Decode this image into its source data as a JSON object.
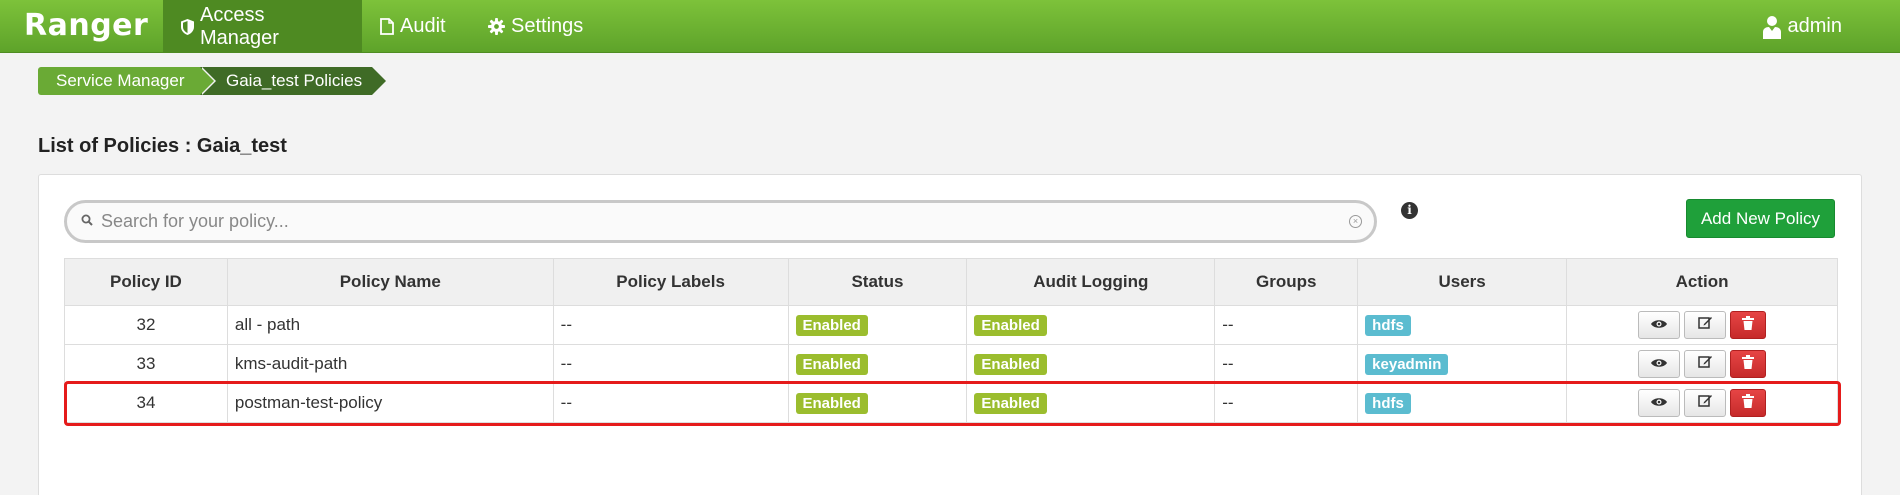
{
  "navbar": {
    "brand": "Ranger",
    "items": [
      {
        "label": "Access Manager",
        "icon": "shield-icon"
      },
      {
        "label": "Audit",
        "icon": "file-icon"
      },
      {
        "label": "Settings",
        "icon": "gear-icon"
      }
    ],
    "user": {
      "label": "admin",
      "icon": "user-icon"
    }
  },
  "breadcrumb": [
    "Service Manager",
    "Gaia_test Policies"
  ],
  "page_title": "List of Policies : Gaia_test",
  "search": {
    "placeholder": "Search for your policy..."
  },
  "add_button": "Add New Policy",
  "table": {
    "headers": [
      "Policy ID",
      "Policy Name",
      "Policy Labels",
      "Status",
      "Audit Logging",
      "Groups",
      "Users",
      "Action"
    ],
    "rows": [
      {
        "id": "32",
        "name": "all - path",
        "labels": "--",
        "status": "Enabled",
        "audit": "Enabled",
        "groups": "--",
        "users": "hdfs"
      },
      {
        "id": "33",
        "name": "kms-audit-path",
        "labels": "--",
        "status": "Enabled",
        "audit": "Enabled",
        "groups": "--",
        "users": "keyadmin"
      },
      {
        "id": "34",
        "name": "postman-test-policy",
        "labels": "--",
        "status": "Enabled",
        "audit": "Enabled",
        "groups": "--",
        "users": "hdfs"
      }
    ]
  },
  "colors": {
    "brand_green": "#6aaa35",
    "highlight_red": "#e51b1b",
    "add_button": "#1fa03a"
  }
}
